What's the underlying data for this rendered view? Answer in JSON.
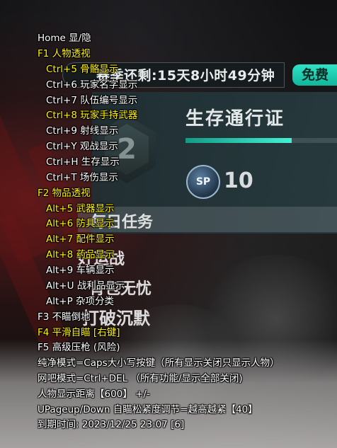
{
  "game": {
    "timer_text": "赛季还剩:15天8小时49分钟",
    "free_label": "免费",
    "pass_title": "生存通行证",
    "pass_progress": 0.7,
    "rank_glyph": "2",
    "sp_label": "SP",
    "sp_value": "10",
    "labels": [
      "每日任务",
      "好运战",
      "背包无忧",
      "打破沉默"
    ]
  },
  "menu": {
    "lines": [
      {
        "text": "Home 显/隐",
        "color": "white"
      },
      {
        "text": "F1 人物透视",
        "color": "yellow"
      },
      {
        "text": "Ctrl+5 骨骼显示",
        "color": "yellow"
      },
      {
        "text": "Ctrl+6 玩家名字显示",
        "color": "white"
      },
      {
        "text": "Ctrl+7 队伍编号显示",
        "color": "white"
      },
      {
        "text": "Ctrl+8 玩家手持武器",
        "color": "yellow"
      },
      {
        "text": "Ctrl+9 射线显示",
        "color": "white"
      },
      {
        "text": "Ctrl+Y 观战显示",
        "color": "white"
      },
      {
        "text": "Ctrl+H 生存显示",
        "color": "white"
      },
      {
        "text": "Ctrl+T 场伤显示",
        "color": "white"
      },
      {
        "text": "F2 物品透视",
        "color": "yellow"
      },
      {
        "text": "Alt+5 武器显示",
        "color": "yellow"
      },
      {
        "text": "Alt+6 防具显示",
        "color": "yellow"
      },
      {
        "text": "Alt+7 配件显示",
        "color": "yellow"
      },
      {
        "text": "Alt+8 药品显示",
        "color": "yellow"
      },
      {
        "text": "Alt+9 车辆显示",
        "color": "white"
      },
      {
        "text": "Alt+U 战利品显示",
        "color": "white"
      },
      {
        "text": "Alt+P 杂项分类",
        "color": "white"
      },
      {
        "text": "F3 不瞄倒地",
        "color": "white"
      },
      {
        "text": "F4 平滑自瞄 [右键]",
        "color": "yellow"
      },
      {
        "text": "F5 高级压枪 (风险)",
        "color": "white"
      },
      {
        "text": "纯净模式=Caps大小写按键（所有显示关闭只显示人物）",
        "color": "white"
      },
      {
        "text": "网吧模式=Ctrl+DEL （所有功能/显示全部关闭)",
        "color": "white"
      },
      {
        "text": "人物显示距离【600】 +/-",
        "color": "white"
      },
      {
        "text": "UPageup/Down 自瞄松紧度调节=越高越紧【40】",
        "color": "white"
      },
      {
        "text": "到期时间: 2023/12/25 23:07 [6]",
        "color": "white"
      }
    ]
  },
  "colors": {
    "menu_white": "#ffffff",
    "menu_yellow": "#fff200",
    "accent_teal": "#2fe3c6"
  }
}
